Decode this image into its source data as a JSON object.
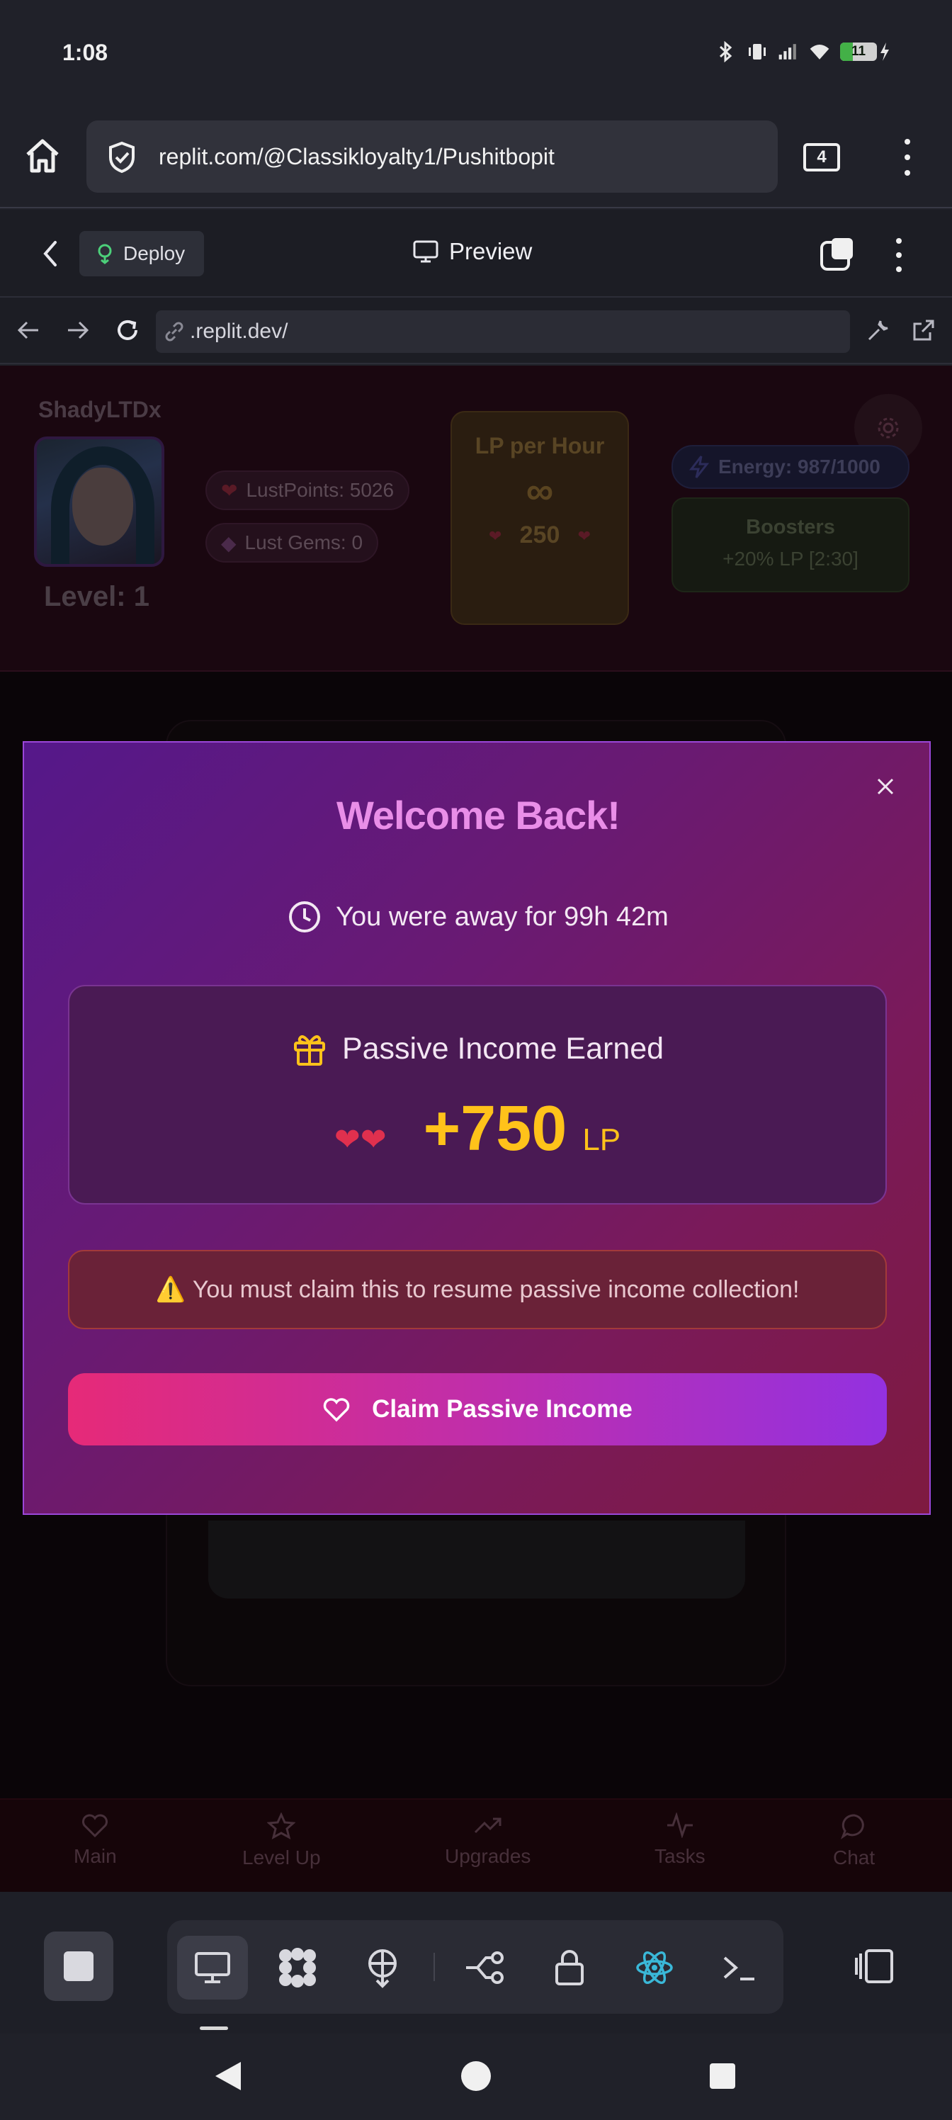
{
  "status_bar": {
    "time": "1:08",
    "battery": "11"
  },
  "browser": {
    "url": "replit.com/@Classikloyalty1/Pushitbopit",
    "tab_count": "4"
  },
  "replit_header": {
    "deploy_label": "Deploy",
    "preview_label": "Preview"
  },
  "webview": {
    "address": ".replit.dev/"
  },
  "app": {
    "username": "ShadyLTDx",
    "level": "Level: 1",
    "lust_points": "LustPoints: 5026",
    "lust_gems": "Lust Gems: 0",
    "lp_per_hour_title": "LP per Hour",
    "lp_per_hour_symbol": "∞",
    "lp_per_hour_value": "250",
    "energy": "Energy: 987/1000",
    "boosters_title": "Boosters",
    "boosters_value": "+20% LP [2:30]",
    "nav": [
      {
        "label": "Main",
        "icon": "heart-icon"
      },
      {
        "label": "Level Up",
        "icon": "star-icon"
      },
      {
        "label": "Upgrades",
        "icon": "trending-up-icon"
      },
      {
        "label": "Tasks",
        "icon": "activity-icon"
      },
      {
        "label": "Chat",
        "icon": "chat-bubble-icon"
      }
    ]
  },
  "modal": {
    "title": "Welcome Back!",
    "away_text": "You were away for 99h 42m",
    "income_title": "Passive Income Earned",
    "amount": "+750",
    "unit": "LP",
    "warning_icon": "⚠️",
    "warning": "You must claim this to resume passive income collection!",
    "claim_label": "Claim Passive Income"
  },
  "colors": {
    "modal_title": "#e98ee8",
    "amount": "#ffc21a",
    "claim_start": "#e62a78",
    "claim_end": "#9331e0"
  }
}
